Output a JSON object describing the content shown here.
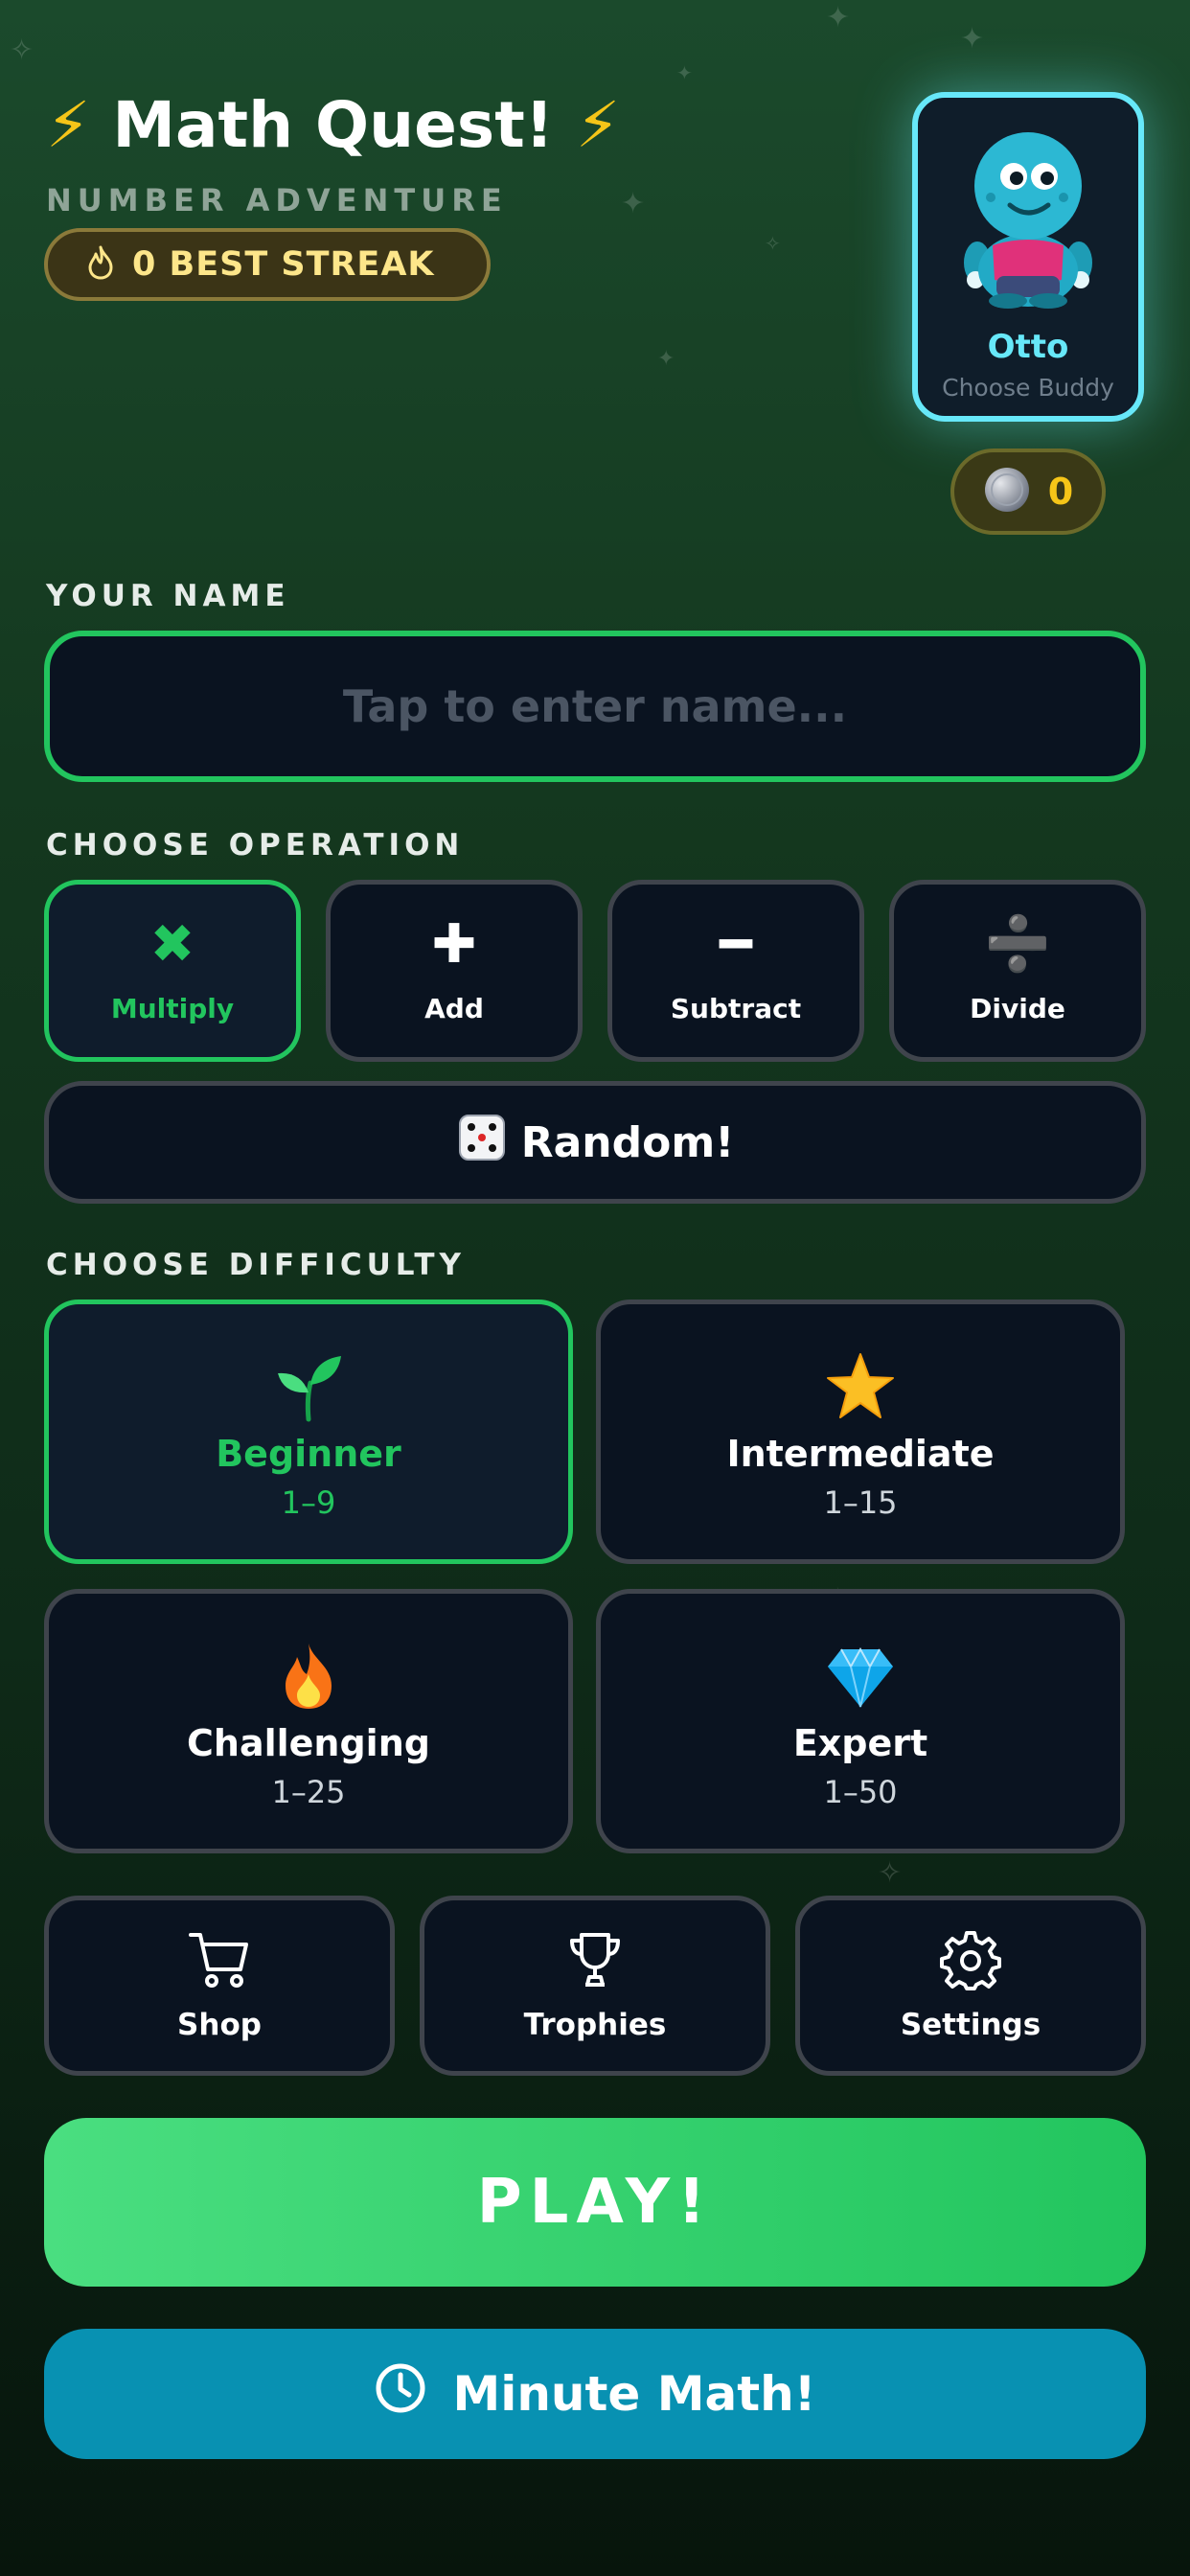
{
  "header": {
    "title": "Math Quest!",
    "title_icon": "lightning-bolt",
    "subtitle": "NUMBER ADVENTURE",
    "streak_label": "0 BEST STREAK",
    "streak_icon": "flame-icon"
  },
  "buddy": {
    "name": "Otto",
    "action": "Choose Buddy",
    "accent": "#67e8f9"
  },
  "coins": {
    "value": "0",
    "icon": "coin-icon"
  },
  "name_section": {
    "label": "YOUR NAME",
    "placeholder": "Tap to enter name...",
    "value": ""
  },
  "operation_section": {
    "label": "CHOOSE OPERATION",
    "options": [
      {
        "symbol": "✖",
        "label": "Multiply",
        "selected": true
      },
      {
        "symbol": "✚",
        "label": "Add",
        "selected": false
      },
      {
        "symbol": "━",
        "label": "Subtract",
        "selected": false
      },
      {
        "symbol": "➗",
        "label": "Divide",
        "selected": false
      }
    ],
    "random_label": "Random!",
    "random_icon": "dice-icon"
  },
  "difficulty_section": {
    "label": "CHOOSE DIFFICULTY",
    "levels": [
      {
        "icon": "seedling-icon",
        "name": "Beginner",
        "range": "1–9",
        "selected": true
      },
      {
        "icon": "star-icon",
        "name": "Intermediate",
        "range": "1–15",
        "selected": false
      },
      {
        "icon": "fire-icon",
        "name": "Challenging",
        "range": "1–25",
        "selected": false
      },
      {
        "icon": "gem-icon",
        "name": "Expert",
        "range": "1–50",
        "selected": false
      }
    ]
  },
  "nav": {
    "shop": "Shop",
    "trophies": "Trophies",
    "settings": "Settings"
  },
  "actions": {
    "play": "PLAY!",
    "minute_math": "Minute Math!"
  },
  "colors": {
    "accent_green": "#22c55e",
    "play_gradient_start": "#4ade80",
    "minute_math": "#0891b2",
    "gold": "#f5c518"
  }
}
